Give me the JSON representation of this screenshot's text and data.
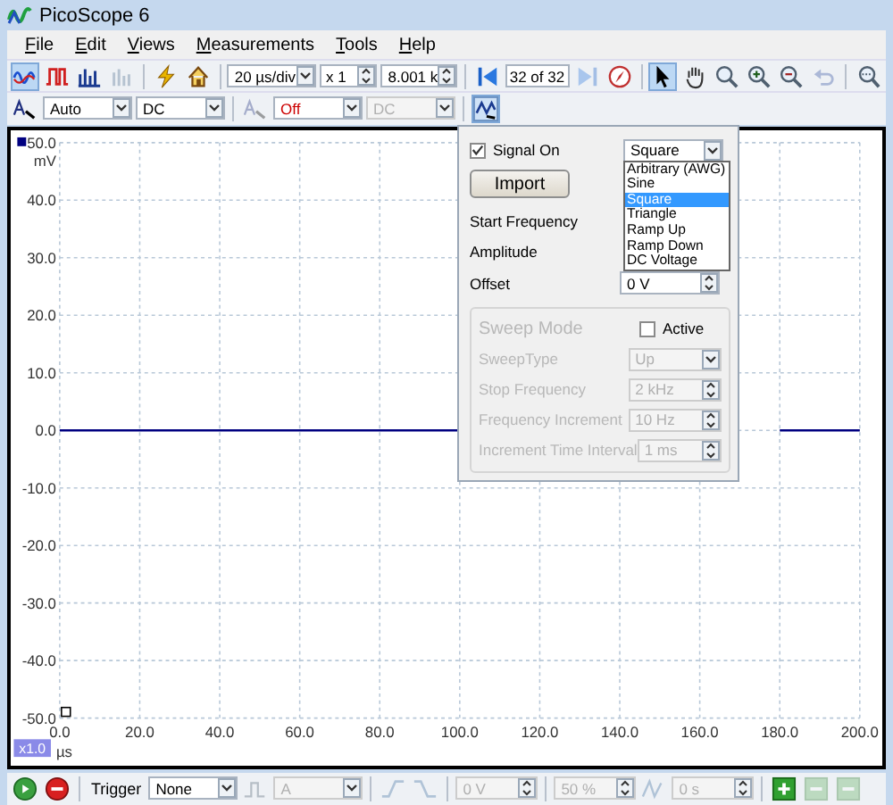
{
  "window": {
    "title": "PicoScope 6"
  },
  "menu": [
    {
      "label": "File"
    },
    {
      "label": "Edit"
    },
    {
      "label": "Views"
    },
    {
      "label": "Measurements"
    },
    {
      "label": "Tools"
    },
    {
      "label": "Help"
    }
  ],
  "toolbar": [
    {
      "kind": "wave",
      "selected": true,
      "disabled": false
    },
    {
      "kind": "pulse",
      "selected": false,
      "disabled": false
    },
    {
      "kind": "bars",
      "selected": false,
      "disabled": false
    },
    {
      "kind": "persist",
      "selected": false,
      "disabled": true
    },
    {
      "kind": "sep"
    },
    {
      "kind": "lightning",
      "selected": false,
      "disabled": false
    },
    {
      "kind": "home",
      "selected": false,
      "disabled": false
    },
    {
      "kind": "sep"
    },
    {
      "kind": "dropdown",
      "value": "20 µs/div",
      "disabled": false
    },
    {
      "kind": "spin",
      "value": "x 1",
      "disabled": false
    },
    {
      "kind": "spin",
      "value": "8.001 k",
      "disabled": false
    },
    {
      "kind": "sep"
    },
    {
      "kind": "back",
      "selected": false,
      "disabled": false
    },
    {
      "kind": "field",
      "value": "32 of 32",
      "disabled": false
    },
    {
      "kind": "forward",
      "selected": false,
      "disabled": true
    },
    {
      "kind": "compass",
      "selected": false,
      "disabled": false
    },
    {
      "kind": "sep"
    },
    {
      "kind": "pointer",
      "selected": true,
      "disabled": false
    },
    {
      "kind": "hand",
      "selected": false,
      "disabled": false
    },
    {
      "kind": "zoom",
      "selected": false,
      "disabled": false
    },
    {
      "kind": "zoomin",
      "selected": false,
      "disabled": false
    },
    {
      "kind": "zoomout",
      "selected": false,
      "disabled": false
    },
    {
      "kind": "undo",
      "selected": false,
      "disabled": true
    },
    {
      "kind": "sep"
    },
    {
      "kind": "zoomfit",
      "selected": false,
      "disabled": false
    }
  ],
  "channel_toolbar": [
    {
      "kind": "channel",
      "selected": false,
      "disabled": false
    },
    {
      "kind": "dropdown",
      "value": "Auto",
      "disabled": false
    },
    {
      "kind": "dropdown",
      "value": "DC",
      "disabled": false
    },
    {
      "kind": "sep"
    },
    {
      "kind": "channel",
      "selected": false,
      "disabled": true
    },
    {
      "kind": "dropdown",
      "value": "Off",
      "disabled": false,
      "color": "#cc0000"
    },
    {
      "kind": "dropdown",
      "value": "DC",
      "disabled": true
    },
    {
      "kind": "sep"
    },
    {
      "kind": "siggen",
      "selected": true,
      "disabled": false
    }
  ],
  "signal_generator": {
    "signal_on": {
      "label": "Signal On",
      "checked": true
    },
    "waveform": {
      "value": "Square",
      "expanded": true,
      "options": [
        {
          "label": "Arbitrary (AWG)",
          "selected": false
        },
        {
          "label": "Sine",
          "selected": false
        },
        {
          "label": "Square",
          "selected": true
        },
        {
          "label": "Triangle",
          "selected": false
        },
        {
          "label": "Ramp Up",
          "selected": false
        },
        {
          "label": "Ramp Down",
          "selected": false
        },
        {
          "label": "DC Voltage",
          "selected": false
        }
      ]
    },
    "import_button": "Import",
    "rows": [
      {
        "label": "Start Frequency"
      },
      {
        "label": "Amplitude"
      },
      {
        "label": "Offset",
        "value": "0 V"
      }
    ],
    "sweep": {
      "title": "Sweep Mode",
      "disabled": true,
      "active": {
        "label": "Active",
        "checked": false
      },
      "rows": [
        {
          "label": "SweepType",
          "kind": "dropdown",
          "value": "Up"
        },
        {
          "label": "Stop Frequency",
          "kind": "spin",
          "value": "2 kHz"
        },
        {
          "label": "Frequency Increment",
          "kind": "spin",
          "value": "10 Hz"
        },
        {
          "label": "Increment Time Interval",
          "kind": "spin",
          "value": "1 ms"
        }
      ]
    }
  },
  "chart": {
    "zoom_badge": "x1.0",
    "chart_data": {
      "type": "line",
      "xlabel": "µs",
      "ylabel": "mV",
      "x": [
        0,
        20,
        40,
        60,
        80,
        100,
        180,
        200
      ],
      "series": [
        {
          "color": "#000080",
          "values": [
            0,
            0,
            0,
            0,
            0,
            0,
            0,
            0
          ]
        }
      ],
      "grid": true,
      "xlim": [
        0,
        200
      ],
      "ylim": [
        -50,
        50
      ],
      "xticks": [
        {
          "value": 0,
          "label": "0.0"
        },
        {
          "value": 20,
          "label": "20.0"
        },
        {
          "value": 40,
          "label": "40.0"
        },
        {
          "value": 60,
          "label": "60.0"
        },
        {
          "value": 80,
          "label": "80.0"
        },
        {
          "value": 100,
          "label": "100.0"
        },
        {
          "value": 120,
          "label": "120.0"
        },
        {
          "value": 140,
          "label": "140.0"
        },
        {
          "value": 160,
          "label": "160.0"
        },
        {
          "value": 180,
          "label": "180.0"
        },
        {
          "value": 200,
          "label": "200.0"
        }
      ],
      "yticks": [
        {
          "value": 50,
          "label": "50.0"
        },
        {
          "value": 40,
          "label": "40.0"
        },
        {
          "value": 30,
          "label": "30.0"
        },
        {
          "value": 20,
          "label": "20.0"
        },
        {
          "value": 10,
          "label": "10.0"
        },
        {
          "value": 0,
          "label": "0.0"
        },
        {
          "value": -10,
          "label": "-10.0"
        },
        {
          "value": -20,
          "label": "-20.0"
        },
        {
          "value": -30,
          "label": "-30.0"
        },
        {
          "value": -40,
          "label": "-40.0"
        },
        {
          "value": -50,
          "label": "-50.0"
        }
      ]
    }
  },
  "trigger_toolbar": [
    {
      "kind": "run",
      "selected": false,
      "disabled": false
    },
    {
      "kind": "stop",
      "selected": false,
      "disabled": false
    },
    {
      "kind": "sep"
    },
    {
      "kind": "label",
      "value": "Trigger"
    },
    {
      "kind": "dropdown",
      "value": "None",
      "disabled": false
    },
    {
      "kind": "trigger",
      "selected": false,
      "disabled": true
    },
    {
      "kind": "dropdown",
      "value": "A",
      "disabled": true
    },
    {
      "kind": "sep"
    },
    {
      "kind": "rise",
      "selected": false,
      "disabled": true
    },
    {
      "kind": "fall",
      "selected": false,
      "disabled": true
    },
    {
      "kind": "sep"
    },
    {
      "kind": "spin",
      "value": "0 V",
      "disabled": true
    },
    {
      "kind": "sep"
    },
    {
      "kind": "spin",
      "value": "50 %",
      "disabled": true
    },
    {
      "kind": "delay",
      "selected": false,
      "disabled": true
    },
    {
      "kind": "spin",
      "value": "0 s",
      "disabled": true
    },
    {
      "kind": "sep"
    },
    {
      "kind": "plus",
      "selected": false,
      "disabled": false
    },
    {
      "kind": "minus",
      "selected": false,
      "disabled": true
    },
    {
      "kind": "minus",
      "selected": false,
      "disabled": true
    }
  ]
}
